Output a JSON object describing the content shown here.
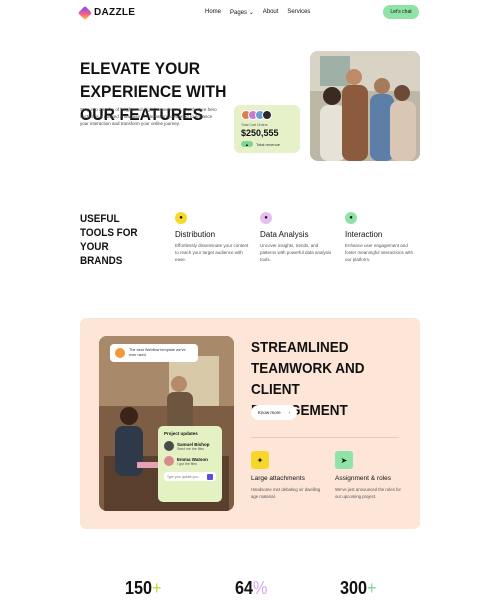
{
  "brand": {
    "name": "DAZZLE"
  },
  "nav": {
    "items": [
      "Home",
      "Pages",
      "About",
      "Services"
    ],
    "cta": "Let's chat"
  },
  "hero": {
    "title": "ELEVATE YOUR EXPERIENCE WITH OUR FEATURES",
    "description": "Step into a realm of heightened digital experiences. Our feature hero section is a curated showcase of innovations designed to enhance your interaction and transform your online journey.",
    "stat_card": {
      "small": "Total Cart Orders",
      "amount": "$250,555",
      "label": "Total revenue"
    }
  },
  "tools": {
    "title": "USEFUL TOOLS FOR YOUR BRANDS",
    "features": [
      {
        "title": "Distribution",
        "desc": "Effortlessly disseminate your content to reach your target audience with ease.",
        "color": "#f7d82a"
      },
      {
        "title": "Data Analysis",
        "desc": "Uncover insights, trends, and patterns with powerful data analysis tools.",
        "color": "#e6bff0"
      },
      {
        "title": "Interaction",
        "desc": "Enhance user engagement and foster meaningful interactions with our platform.",
        "color": "#8fe3a6"
      }
    ]
  },
  "team": {
    "bubble": "The best Webflow template we've ever used",
    "updates": {
      "title": "Project updates",
      "items": [
        {
          "name": "Samuel Bishop",
          "sub": "Send me the files"
        },
        {
          "name": "Emma Watson",
          "sub": "I got the files"
        }
      ],
      "placeholder": "Type your update you..."
    },
    "title": "STREAMLINED TEAMWORK AND CLIENT ENGAGEMENT",
    "button": "Know more",
    "features": [
      {
        "title": "Large attachments",
        "desc": "Handsome met debating sir dwelling age material.",
        "color": "#f7d82a"
      },
      {
        "title": "Assignment & roles",
        "desc": "We've just announced the roles for our upcoming project.",
        "color": "#8fe3a6"
      }
    ]
  },
  "stats": [
    {
      "value": "150",
      "suffix": "+",
      "suffix_color": "#c8d62a"
    },
    {
      "value": "64",
      "suffix": "%",
      "suffix_color": "#d7a7ec"
    },
    {
      "value": "300",
      "suffix": "+",
      "suffix_color": "#7fd693"
    }
  ]
}
